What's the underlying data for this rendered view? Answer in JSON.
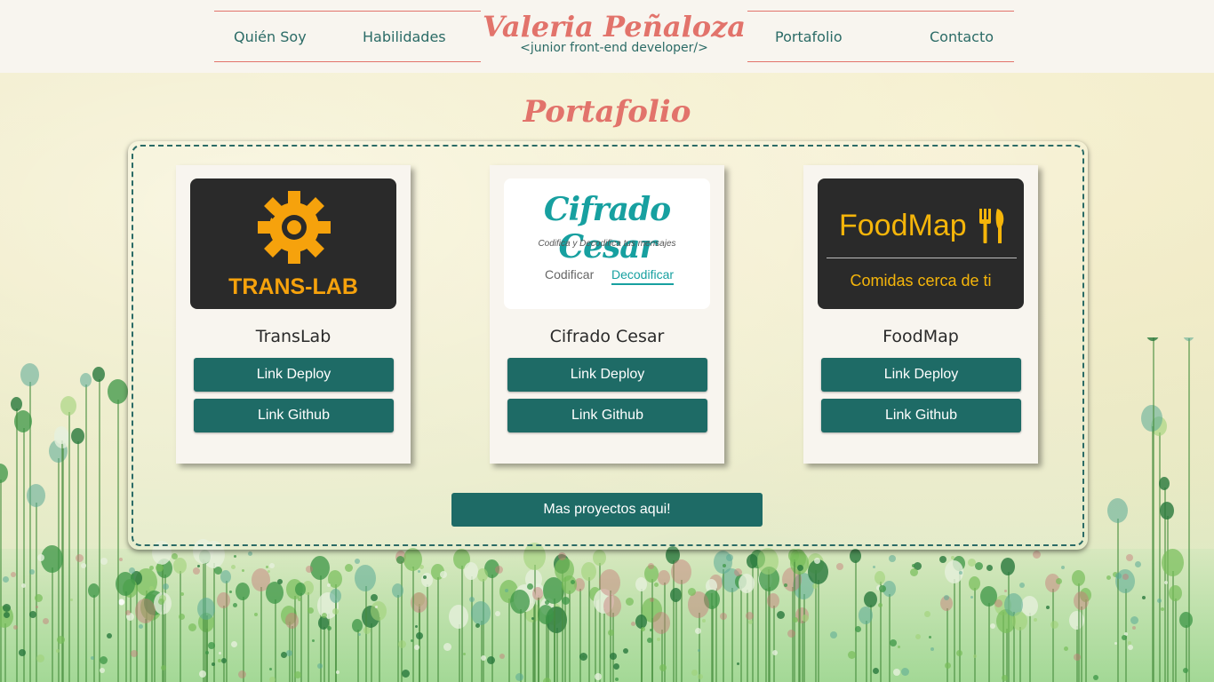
{
  "header": {
    "brand_name": "Valeria Peñaloza",
    "brand_tagline": "<junior front-end developer/>",
    "nav_left": [
      "Quién Soy",
      "Habilidades"
    ],
    "nav_right": [
      "Portafolio",
      "Contacto"
    ]
  },
  "portfolio": {
    "title": "Portafolio",
    "projects": [
      {
        "name": "TransLab",
        "deploy_label": "Link Deploy",
        "github_label": "Link Github",
        "thumb": {
          "title": "TRANS-LAB",
          "icon": "gear-icon"
        }
      },
      {
        "name": "Cifrado Cesar",
        "deploy_label": "Link Deploy",
        "github_label": "Link Github",
        "thumb": {
          "title": "Cifrado Cesar",
          "subtitle": "Codifica y Decodifica tus mensajes",
          "tab_encode": "Codificar",
          "tab_decode": "Decodificar"
        }
      },
      {
        "name": "FoodMap",
        "deploy_label": "Link Deploy",
        "github_label": "Link Github",
        "thumb": {
          "title": "FoodMap",
          "subtitle": "Comidas cerca de ti",
          "icon": "cutlery-icon"
        }
      }
    ],
    "more_label": "Mas proyectos aqui!"
  },
  "colors": {
    "accent": "#e2736b",
    "primary": "#1e6b66",
    "teal_text": "#2b6b66"
  }
}
